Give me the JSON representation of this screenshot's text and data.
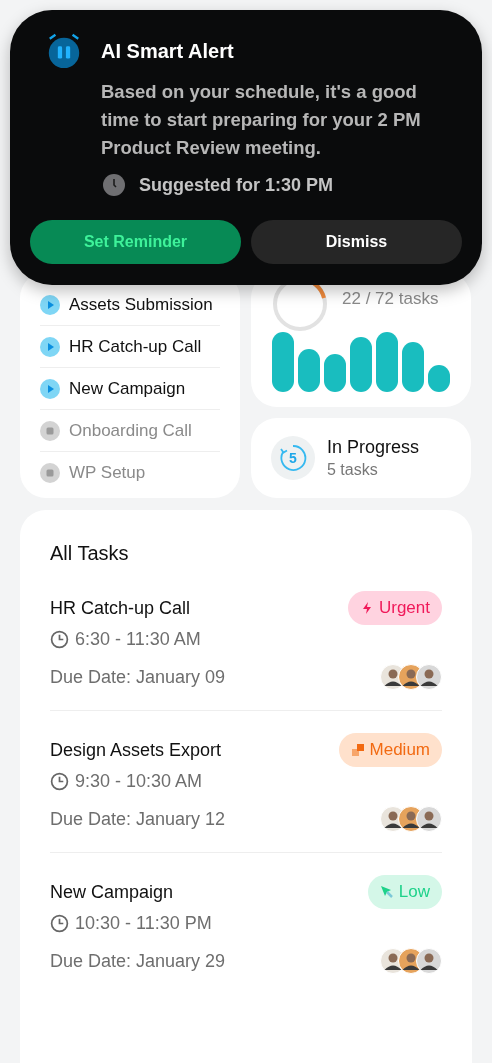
{
  "alert": {
    "title": "AI Smart Alert",
    "message": "Based on your schedule, it's a good time to start preparing for your 2 PM Product Review meeting.",
    "suggestion": "Suggested for 1:30 PM",
    "buttons": [
      {
        "label": "Set Reminder",
        "kind": "primary"
      },
      {
        "label": "Dismiss",
        "kind": "secondary"
      }
    ]
  },
  "task_list": [
    {
      "name": "Assets Submission",
      "active": true
    },
    {
      "name": "HR Catch-up Call",
      "active": true
    },
    {
      "name": "New Campaign",
      "active": true
    },
    {
      "name": "Onboarding Call",
      "active": false
    },
    {
      "name": "WP Setup",
      "active": false
    }
  ],
  "progress": {
    "count": "22 / 72 tasks"
  },
  "in_progress": {
    "title": "In Progress",
    "number": "5",
    "count": "5 tasks"
  },
  "all_tasks": {
    "title": "All Tasks",
    "tasks": [
      {
        "name": "HR Catch-up Call",
        "priority": "Urgent",
        "kind": "urgent",
        "time": "6:30 - 11:30 AM",
        "due": "Due Date: January 09"
      },
      {
        "name": "Design Assets Export",
        "priority": "Medium",
        "kind": "medium",
        "time": "9:30 - 10:30 AM",
        "due": "Due Date: January 12"
      },
      {
        "name": "New Campaign",
        "priority": "Low",
        "kind": "low",
        "time": "10:30 - 11:30 PM",
        "due": "Due Date: January 29"
      }
    ]
  }
}
